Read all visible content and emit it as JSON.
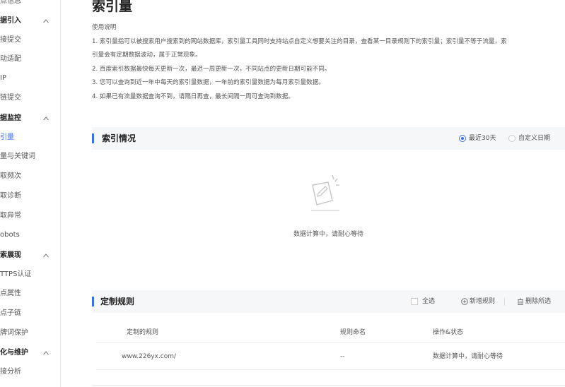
{
  "sidebar": {
    "items": [
      {
        "label": "点信息",
        "type": "item"
      },
      {
        "label": "据引入",
        "type": "group"
      },
      {
        "label": "接提交",
        "type": "item"
      },
      {
        "label": "动适配",
        "type": "item"
      },
      {
        "label": "IP",
        "type": "item"
      },
      {
        "label": "链提交",
        "type": "item"
      },
      {
        "label": "据监控",
        "type": "group"
      },
      {
        "label": "引量",
        "type": "item",
        "active": true
      },
      {
        "label": "量与关键词",
        "type": "item"
      },
      {
        "label": "取频次",
        "type": "item"
      },
      {
        "label": "取诊断",
        "type": "item"
      },
      {
        "label": "取异常",
        "type": "item"
      },
      {
        "label": "obots",
        "type": "item"
      },
      {
        "label": "索展现",
        "type": "group"
      },
      {
        "label": "TTPS认证",
        "type": "item"
      },
      {
        "label": "点属性",
        "type": "item"
      },
      {
        "label": "点子链",
        "type": "item"
      },
      {
        "label": "牌词保护",
        "type": "item"
      },
      {
        "label": "化与维护",
        "type": "group"
      },
      {
        "label": "接分析",
        "type": "item"
      }
    ]
  },
  "page": {
    "title": "索引量",
    "usage_title": "使用说明",
    "usage_lines": [
      "1. 索引量指可以被搜索用户搜索到的网站数据库，索引量工具同时支持站点自定义想要关注的目录，查看某一目录规则下的索引量；索引量不等于流量，索",
      "引量会有定期数据波动，属于正常现象。",
      "2. 百度索引数据最快每天更新一次，最迟一周更新一次，不同站点的更新日期可能不同。",
      "3. 您可以查询到近一年中每天的索引量数据，一年前的索引量数据为每月索引量数据。",
      "4. 如果已有流量数据查询不到，请隔日再查，最长间隔一周可查询到数据。"
    ]
  },
  "index_panel": {
    "title": "索引情况",
    "radio_30d": "最近30天",
    "radio_custom": "自定义日期",
    "selected": "最近30天",
    "empty_text": "数据计算中，请耐心等待"
  },
  "rules_panel": {
    "title": "定制规则",
    "select_all": "全选",
    "add_rule": "新增规则",
    "delete_selected": "删除所选",
    "columns": [
      "定制的规则",
      "规则命名",
      "操作&状态"
    ],
    "rows": [
      {
        "rule": "www.226yx.com/",
        "name": "--",
        "status": "数据计算中，请耐心等待"
      }
    ]
  },
  "colors": {
    "accent": "#3b6ee8",
    "panel_bg": "#f6f7f9"
  }
}
